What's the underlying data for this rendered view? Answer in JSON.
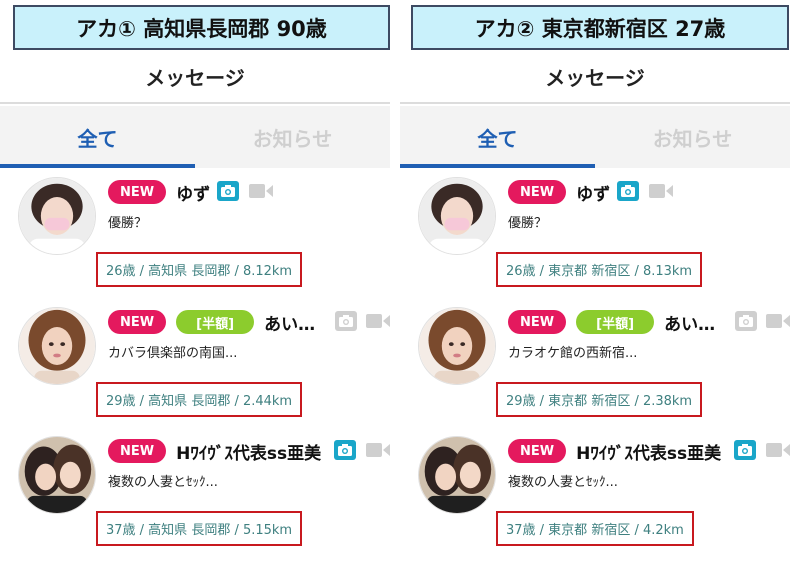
{
  "panels": [
    {
      "account_label": "アカ① 高知県長岡郡 90歳",
      "header_title": "メッセージ",
      "tabs": [
        {
          "label": "全て",
          "active": true
        },
        {
          "label": "お知らせ",
          "active": false
        }
      ],
      "messages": [
        {
          "badges": [
            "NEW"
          ],
          "sender": "ゆず",
          "camera": "active",
          "video": "inactive",
          "preview": "優勝？",
          "meta": "26歳 / 高知県 長岡郡 / 8.12km"
        },
        {
          "badges": [
            "NEW",
            "[半額]"
          ],
          "sender": "あい…",
          "camera": "inactive",
          "video": "inactive",
          "preview": "カバラ倶楽部の南国...",
          "meta": "29歳 / 高知県 長岡郡 / 2.44km"
        },
        {
          "badges": [
            "NEW"
          ],
          "sender": "Hﾜｲｳﾞｽ代表ss亜美",
          "camera": "active",
          "video": "inactive",
          "preview": "複数の人妻とｾｯｸ...",
          "meta": "37歳 / 高知県 長岡郡 / 5.15km"
        }
      ]
    },
    {
      "account_label": "アカ② 東京都新宿区 27歳",
      "header_title": "メッセージ",
      "tabs": [
        {
          "label": "全て",
          "active": true
        },
        {
          "label": "お知らせ",
          "active": false
        }
      ],
      "messages": [
        {
          "badges": [
            "NEW"
          ],
          "sender": "ゆず",
          "camera": "active",
          "video": "inactive",
          "preview": "優勝？",
          "meta": "26歳 / 東京都 新宿区 / 8.13km"
        },
        {
          "badges": [
            "NEW",
            "[半額]"
          ],
          "sender": "あい…",
          "camera": "inactive",
          "video": "inactive",
          "preview": "カラオケ館の西新宿...",
          "meta": "29歳 / 東京都 新宿区 / 2.38km"
        },
        {
          "badges": [
            "NEW"
          ],
          "sender": "Hﾜｲｳﾞｽ代表ss亜美",
          "camera": "active",
          "video": "inactive",
          "preview": "複数の人妻とｾｯｸ...",
          "meta": "37歳 / 東京都 新宿区 / 4.2km"
        }
      ]
    }
  ],
  "icons": {
    "camera": "camera-icon",
    "video": "video-camera-icon",
    "avatar": "avatar-photo"
  },
  "colors": {
    "new_badge": "#e4195e",
    "half_price_badge": "#8ccc2d",
    "active_tab": "#1f5fb3",
    "camera_active": "#1aa6c9",
    "icon_inactive": "#cfcfcf",
    "meta_text": "#3f8080",
    "highlight_box": "#c8191f",
    "account_banner_bg": "#c9f1fb"
  }
}
